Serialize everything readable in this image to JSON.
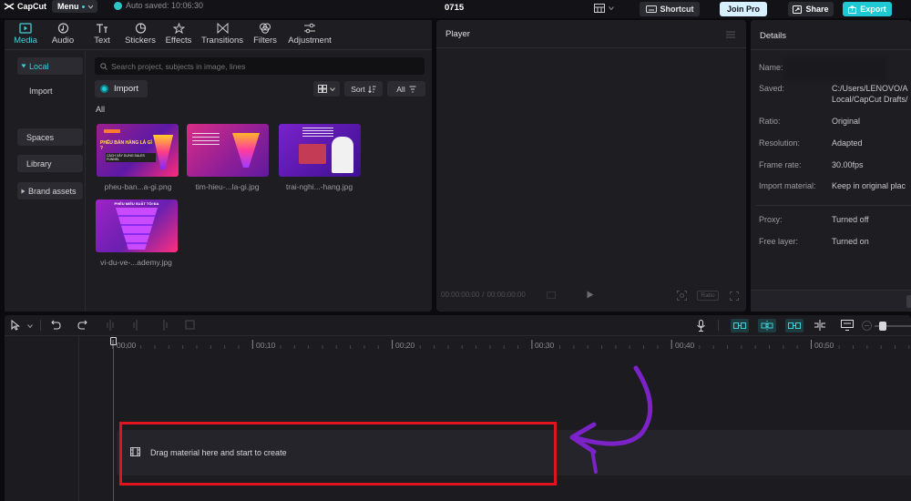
{
  "app": {
    "name": "CapCut",
    "menu_label": "Menu",
    "autosave": "Auto saved: 10:06:30",
    "project_name": "0715"
  },
  "topbar": {
    "shortcut_label": "Shortcut",
    "joinpro_label": "Join Pro",
    "share_label": "Share",
    "export_label": "Export"
  },
  "media_tabs": [
    {
      "label": "Media",
      "icon": "media-icon",
      "active": true
    },
    {
      "label": "Audio",
      "icon": "audio-icon"
    },
    {
      "label": "Text",
      "icon": "text-icon"
    },
    {
      "label": "Stickers",
      "icon": "sticker-icon"
    },
    {
      "label": "Effects",
      "icon": "effects-icon"
    },
    {
      "label": "Transitions",
      "icon": "transitions-icon"
    },
    {
      "label": "Filters",
      "icon": "filters-icon"
    },
    {
      "label": "Adjustment",
      "icon": "adjustment-icon"
    }
  ],
  "sidebar": {
    "local": "Local",
    "import": "Import",
    "spaces": "Spaces",
    "library": "Library",
    "brand_assets": "Brand assets"
  },
  "search": {
    "placeholder": "Search project, subjects in image, lines"
  },
  "library": {
    "import_label": "Import",
    "sort_label": "Sort",
    "filter_label": "All",
    "section_label": "All",
    "items": [
      {
        "name": "pheu-ban...a-gi.png",
        "caption": "PHỄU BÁN HÀNG LÀ GÌ ?",
        "subcaption": "CÁCH XÂY DỰNG SALES FUNNEL"
      },
      {
        "name": "tim-hieu-...la-gi.jpg"
      },
      {
        "name": "trai-nghi...-hang.jpg"
      },
      {
        "name": "vi-du-ve-...ademy.jpg",
        "caption": "PHỄU MIỄU SUẤT TỐI ĐA"
      }
    ]
  },
  "player": {
    "title": "Player",
    "current_time": "00:00:00:00",
    "total_time": "00:00:00:00",
    "ratio_label": "Ratio"
  },
  "details": {
    "title": "Details",
    "rows": [
      {
        "label": "Name:",
        "value": ""
      },
      {
        "label": "Saved:",
        "value": "C:/Users/LENOVO/A",
        "value2": "Local/CapCut Drafts/"
      },
      {
        "label": "Ratio:",
        "value": "Original"
      },
      {
        "label": "Resolution:",
        "value": "Adapted"
      },
      {
        "label": "Frame rate:",
        "value": "30.00fps"
      },
      {
        "label": "Import material:",
        "value": "Keep in original plac"
      },
      {
        "label": "Proxy:",
        "value": "Turned off"
      },
      {
        "label": "Free layer:",
        "value": "Turned on"
      }
    ]
  },
  "timeline": {
    "ticks": [
      "00:00",
      "00:10",
      "00:20",
      "00:30",
      "00:40",
      "00:50"
    ],
    "drop_hint": "Drag material here and start to create"
  },
  "colors": {
    "accent": "#3fd1d6",
    "highlight_box": "#e0141e",
    "arrow": "#7c22c9",
    "joinpro_bg": "#d6f0ff",
    "export_bg": "#1fc9d3"
  }
}
